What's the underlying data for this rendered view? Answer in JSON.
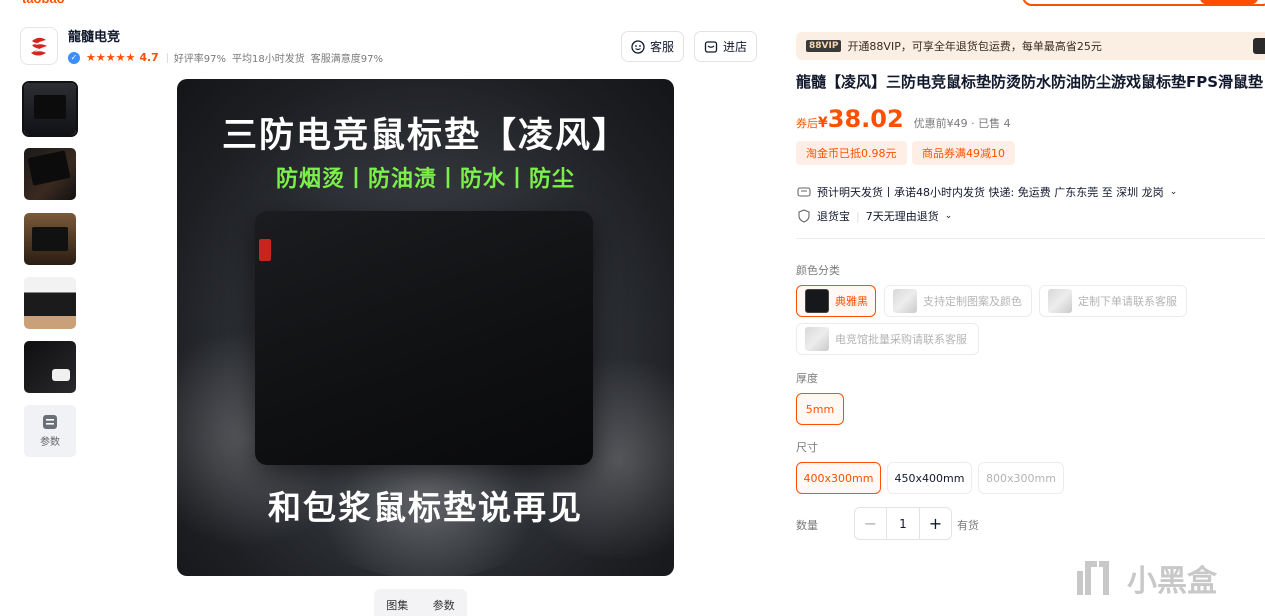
{
  "header": {
    "brand": "taobao"
  },
  "shop": {
    "name": "龍髓电竞",
    "rating": "4.7",
    "good_rate": "好评率97%",
    "ship_time": "平均18小时发货",
    "satisfaction": "客服满意度97%",
    "service_label": "客服",
    "store_label": "进店"
  },
  "gallery": {
    "main_title": "三防电竞鼠标垫【凌风】",
    "main_features": "防烟烫丨防油渍丨防水丨防尘",
    "main_bottom": "和包浆鼠标垫说再见",
    "params_thumb_label": "参数",
    "tabs": [
      "图集",
      "参数"
    ]
  },
  "product": {
    "vip_tag": "88VIP",
    "vip_text": "开通88VIP，可享全年退货包运费，每单最高省25元",
    "title": "龍髓【凌风】三防电竞鼠标垫防烫防水防油防尘游戏鼠标垫FPS滑鼠垫",
    "price_label": "券后",
    "price_symbol": "¥",
    "price": "38.02",
    "price_original": "优惠前¥49 · 已售 4",
    "coupons": [
      "淘金币已抵0.98元",
      "商品券满49减10"
    ],
    "shipping": "预计明天发货丨承诺48小时内发货  快递: 免运费  广东东莞 至 深圳 龙岗",
    "returns_label": "退货宝",
    "returns_text": "7天无理由退货"
  },
  "options": {
    "color_label": "颜色分类",
    "colors": [
      "典雅黑",
      "支持定制图案及颜色",
      "定制下单请联系客服",
      "电竞馆批量采购请联系客服"
    ],
    "thickness_label": "厚度",
    "thickness": [
      "5mm"
    ],
    "size_label": "尺寸",
    "sizes": [
      "400x300mm",
      "450x400mm",
      "800x300mm"
    ],
    "quantity_label": "数量",
    "quantity": "1",
    "stock": "有货"
  },
  "watermark": {
    "text": "小黑盒"
  },
  "colors": {
    "accent": "#ff5000",
    "feature_green": "#7cf04a",
    "coupon_bg": "#ffeee5",
    "vip_bg": "#fbefe4"
  }
}
